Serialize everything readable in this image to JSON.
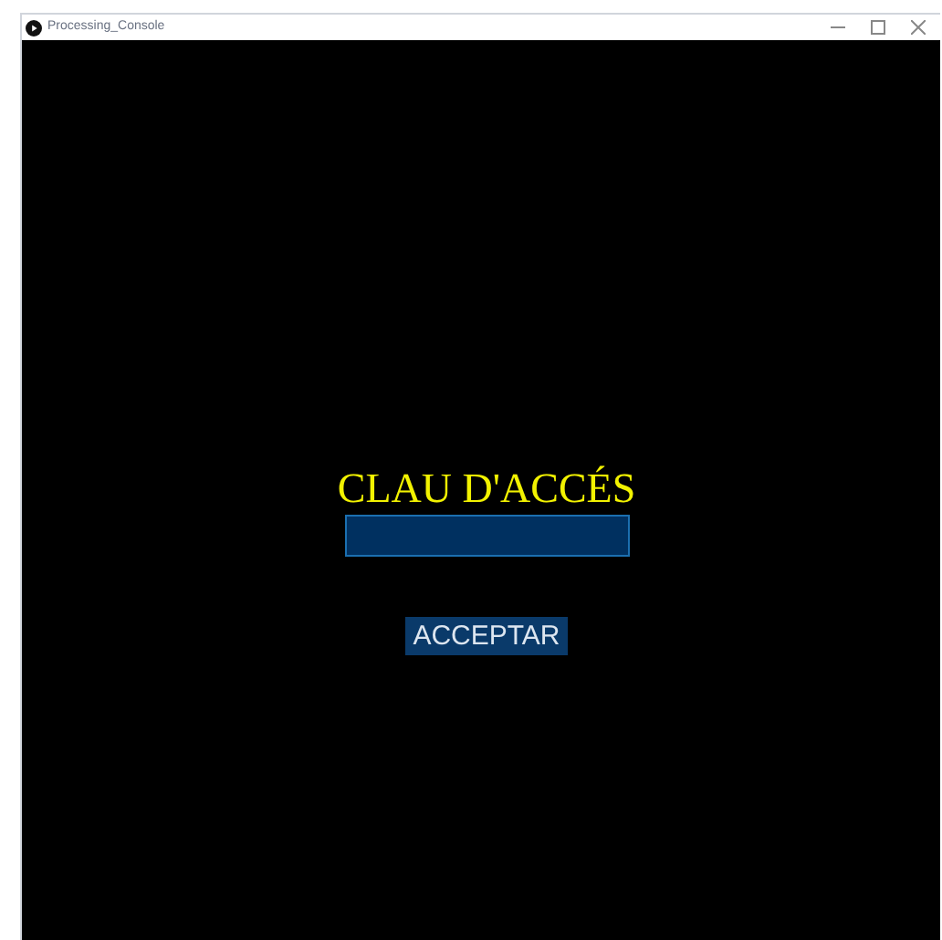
{
  "window": {
    "title": "Processing_Console"
  },
  "heading": "CLAU D'ACCÉS",
  "button": "ACCEPTAR"
}
